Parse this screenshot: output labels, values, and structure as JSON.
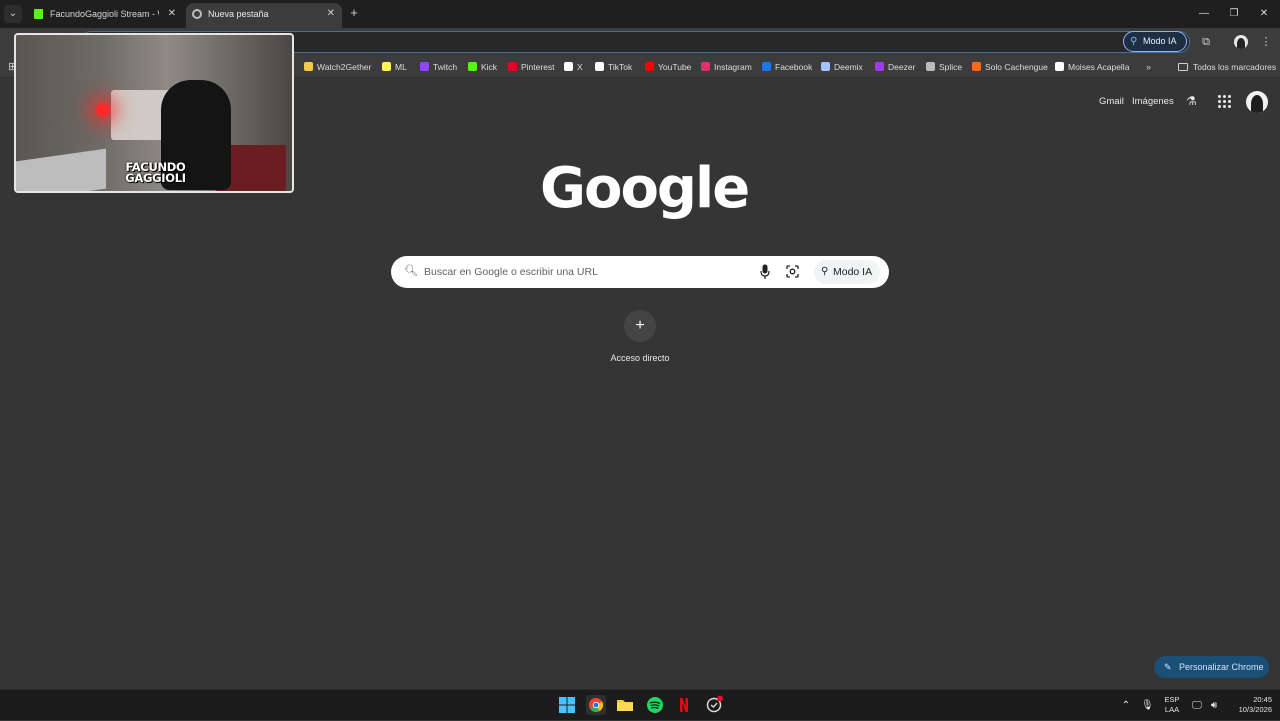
{
  "tabs": [
    {
      "title": "FacundoGaggioli Stream - Watc",
      "favicon": "kick-icon"
    },
    {
      "title": "Nueva pestaña",
      "favicon": "chrome-icon"
    }
  ],
  "toolbar": {
    "modo_ia": "Modo IA"
  },
  "bookmarks": [
    {
      "label": "Watch2Gether",
      "color": "#f2c94c"
    },
    {
      "label": "ML",
      "color": "#fff159"
    },
    {
      "label": "Twitch",
      "color": "#9146ff"
    },
    {
      "label": "Kick",
      "color": "#53fc18"
    },
    {
      "label": "Pinterest",
      "color": "#e60023"
    },
    {
      "label": "X",
      "color": "#ffffff"
    },
    {
      "label": "TikTok",
      "color": "#ffffff"
    },
    {
      "label": "YouTube",
      "color": "#ff0000"
    },
    {
      "label": "Instagram",
      "color": "#e1306c"
    },
    {
      "label": "Facebook",
      "color": "#1877f2"
    },
    {
      "label": "Deemix",
      "color": "#a0c4ff"
    },
    {
      "label": "Deezer",
      "color": "#a238ff"
    },
    {
      "label": "Splice",
      "color": "#bbbbbb"
    },
    {
      "label": "Solo Cachengue",
      "color": "#ff6a13"
    },
    {
      "label": "Moises Acapella",
      "color": "#ffffff"
    }
  ],
  "bookmarks_more": "»",
  "bookmarks_folder": "Todos los marcadores",
  "header": {
    "gmail": "Gmail",
    "images": "Imágenes"
  },
  "logo_text": "Google",
  "search": {
    "placeholder": "Buscar en Google o escribir una URL",
    "modo_ia": "Modo IA"
  },
  "shortcut": {
    "label": "Acceso directo"
  },
  "customize": {
    "label": "Personalizar Chrome"
  },
  "stream_overlay": {
    "line1": "FACUNDO",
    "line2": "GAGGIOLI"
  },
  "taskbar": {
    "lang": "ESP",
    "layout": "LAA",
    "time": "20:45",
    "date": "10/3/2026"
  },
  "colors": {
    "accent": "#8ab4f8",
    "page_bg": "#353535",
    "customize_bg": "#1a5077"
  }
}
